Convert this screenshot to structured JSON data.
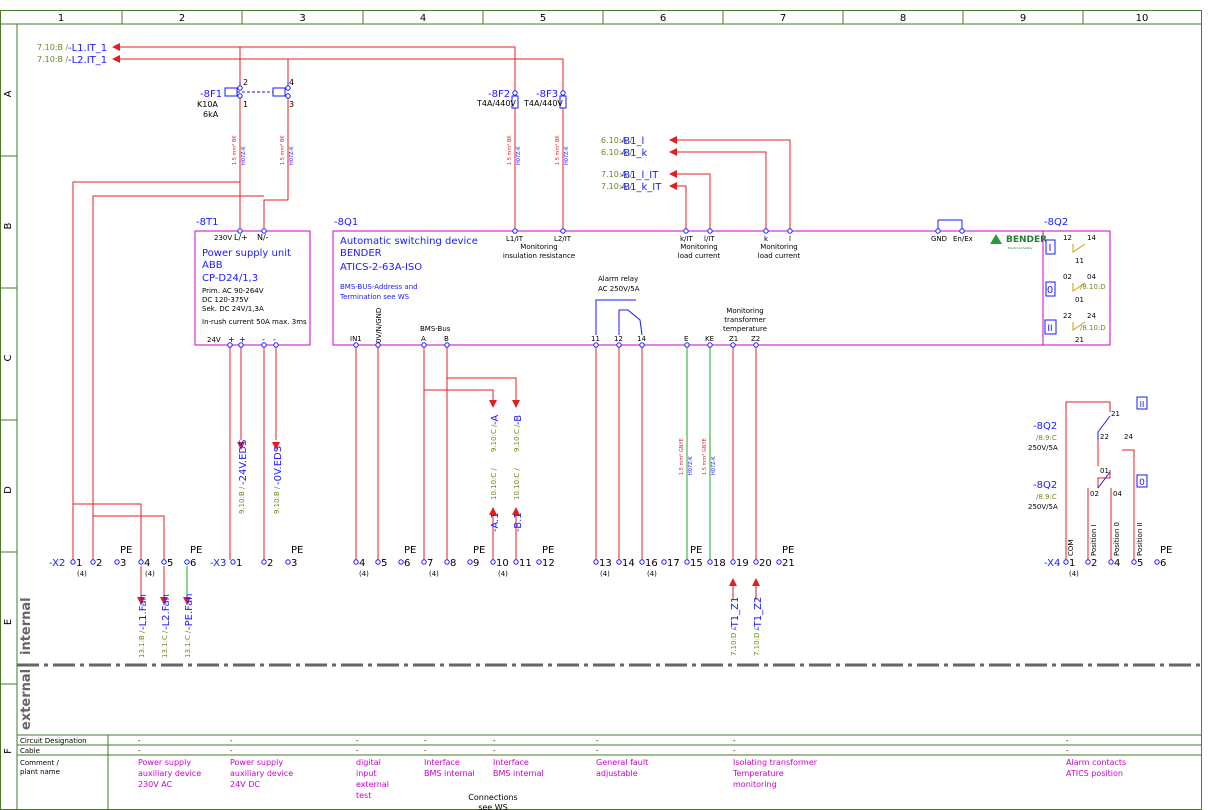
{
  "colors": {
    "wire": "#e02020",
    "box": "#cc00cc",
    "blue": "#1a1aff",
    "green": "#22aa22",
    "grid": "#4a7a2a",
    "ref": "#6a8a20",
    "comment": "#cc00cc"
  },
  "columns": [
    "1",
    "2",
    "3",
    "4",
    "5",
    "6",
    "7",
    "8",
    "9",
    "10"
  ],
  "rows": [
    "A",
    "B",
    "C",
    "D",
    "E",
    "F"
  ],
  "incoming": {
    "l1": {
      "ref": "7.10:B /",
      "name": "-L1.IT_1"
    },
    "l2": {
      "ref": "7.10:B /",
      "name": "-L2.IT_1"
    },
    "b1l": {
      "ref": "6.10:A /",
      "name": "-B1_l"
    },
    "b1k": {
      "ref": "6.10:A /",
      "name": "-B1_k"
    },
    "b1lit": {
      "ref": "7.10:A /",
      "name": "-B1_l_IT"
    },
    "b1kit": {
      "ref": "7.10:A /",
      "name": "-B1_k_IT"
    }
  },
  "fuses": {
    "f1": {
      "tag": "-8F1",
      "rating": "K10A",
      "ka": "6kA",
      "p2": "2",
      "p4": "4",
      "p1": "1",
      "p3": "3"
    },
    "f2": {
      "tag": "-8F2",
      "rating": "T4A/440V"
    },
    "f3": {
      "tag": "-8F3",
      "rating": "T4A/440V"
    }
  },
  "cables": {
    "c15bk": "1.5 mm² BK",
    "h07": "H07Z-K",
    "c15gnye": "1.5 mm² GNYE"
  },
  "t1": {
    "tag": "-8T1",
    "title": "Power supply unit",
    "mfr": "ABB",
    "model": "CP-D24/1,3",
    "prim": "Prim. AC 90-264V",
    "dc": "DC 120-375V",
    "sek": "Sek. DC 24V/1,3A",
    "inrush": "In-rush current 50A max. 3ms",
    "v230": "230V",
    "lp": "L/+",
    "nm": "N/-",
    "v24": "24V",
    "plus": "+",
    "minus": "-"
  },
  "q1": {
    "tag": "-8Q1",
    "title": "Automatic switching device",
    "mfr": "BENDER",
    "model": "ATICS-2-63A-ISO",
    "bms1": "BMS-BUS-Address and",
    "bms2": "Termination see WS",
    "top": {
      "l1": "L1/IT",
      "l2": "L2/IT",
      "mon_ins1": "Monitoring",
      "mon_ins2": "insulation resistance",
      "kit": "k/IT",
      "lit": "l/IT",
      "k": "k",
      "l": "l",
      "mon_load1": "Monitoring",
      "mon_load2": "load current",
      "gnd": "GND",
      "enex": "En/Ex"
    },
    "bottom": {
      "in1": "IN1",
      "ingnd": "0V/N/GND",
      "bmsbus": "BMS-Bus",
      "a": "A",
      "b": "B",
      "alarm1": "Alarm relay",
      "alarm2": "AC 250V/5A",
      "t11": "11",
      "t12": "12",
      "t14": "14",
      "e": "E",
      "ke": "KE",
      "z1": "Z1",
      "z2": "Z2",
      "mon1": "Monitoring",
      "mon2": "transformer",
      "mon3": "temperature"
    }
  },
  "bender": {
    "logo": "BENDER",
    "sub": "Electrical Safety"
  },
  "q2": {
    "tag": "-8Q2",
    "c12": "12",
    "c14": "14",
    "c11": "11",
    "c02": "02",
    "c04": "04",
    "c01": "01",
    "c22": "22",
    "c24": "24",
    "c21": "21",
    "ref": "/8.10:D",
    "pos1": "I",
    "pos0": "0",
    "pos2": "II"
  },
  "outgoing": {
    "v24": {
      "ref": "9.10:B /",
      "name": "-24V.EDS"
    },
    "v0": {
      "ref": "9.10:B /",
      "name": "-0V.EDS"
    },
    "a": {
      "ref": "9.10:C /",
      "name": "-A"
    },
    "b": {
      "ref": "9.10:C /",
      "name": "-B"
    },
    "a1": {
      "ref": "10.10:C /",
      "name": "-A.1"
    },
    "b1": {
      "ref": "10.10:C /",
      "name": "-B.1"
    },
    "fl1": {
      "ref": "13.1:B /",
      "name": "-L1.Fan"
    },
    "fl2": {
      "ref": "13.1:C /",
      "name": "-L2.Fan"
    },
    "fpe": {
      "ref": "13.1:C /",
      "name": "-PE.Fan"
    },
    "tz1": {
      "ref": "7.10:D /",
      "name": "-T1_Z1"
    },
    "tz2": {
      "ref": "7.10:D /",
      "name": "-T1_Z2"
    }
  },
  "q2detail": {
    "tag": "-8Q2",
    "ref": "/8.9:C",
    "rating": "250V/5A",
    "c21": "21",
    "c22": "22",
    "c24": "24",
    "c01": "01",
    "c02": "02",
    "c04": "04",
    "m2": "II",
    "m0": "0"
  },
  "x2": {
    "tag": "-X2",
    "pe": "PE",
    "n4": "(4)"
  },
  "x3": {
    "tag": "-X3",
    "pe": "PE"
  },
  "x4": {
    "tag": "-X4",
    "com": "COM",
    "pI": "Position I",
    "p0": "Position 0",
    "pII": "Position II"
  },
  "zones": {
    "internal": "internal",
    "external": "external"
  },
  "table": {
    "h_circuit": "Circuit Designation",
    "h_cable": "Cable",
    "h_comment1": "Comment /",
    "h_comment2": "plant name",
    "dash": "-",
    "c1": [
      "Power supply",
      "auxiliary device",
      "230V AC"
    ],
    "c2": [
      "Power supply",
      "auxiliary device",
      "24V DC"
    ],
    "c3": [
      "digital",
      "input",
      "external",
      "test"
    ],
    "c4": [
      "Interface",
      "BMS internal"
    ],
    "c5": [
      "Interface",
      "BMS internal"
    ],
    "c6": [
      "General fault",
      "adjustable"
    ],
    "c7": [
      "Isolating transformer",
      "Temperature",
      "monitoring"
    ],
    "c8": [
      "Alarm contacts",
      "ATICS position"
    ],
    "conn1": "Connections",
    "conn2": "see WS"
  }
}
